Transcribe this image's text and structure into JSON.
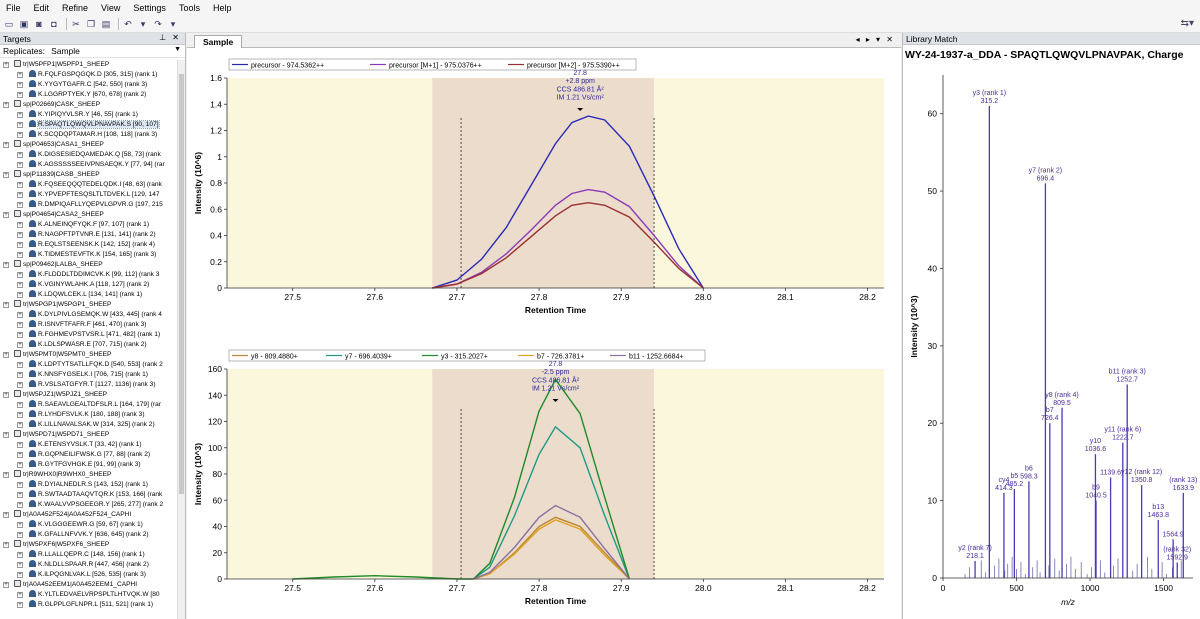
{
  "menu": [
    "File",
    "Edit",
    "Refine",
    "View",
    "Settings",
    "Tools",
    "Help"
  ],
  "targets": {
    "title": "Targets",
    "replicates_label": "Replicates:",
    "replicate_value": "Sample",
    "tree": [
      {
        "t": "prot",
        "label": "tr|W5PFP1|W5PFP1_SHEEP"
      },
      {
        "t": "pep",
        "label": "R.FQLFGSPQGQK.D [305, 315] (rank 1)"
      },
      {
        "t": "pep",
        "label": "K.YYGYTGAFR.C [542, 550] (rank 3)"
      },
      {
        "t": "pep",
        "label": "K.LGGRPTYEK.Y [670, 678] (rank 2)"
      },
      {
        "t": "prot",
        "label": "sp|P02669|CASK_SHEEP"
      },
      {
        "t": "pep",
        "label": "K.YIPIQYVLSR.Y [46, 55] (rank 1)"
      },
      {
        "t": "pep",
        "label": "R.SPAQTLQWQVLPNAVPAK.S [90, 107]",
        "sel": true
      },
      {
        "t": "pep",
        "label": "K.SCQDQPTAMAR.H [108, 118] (rank 3)"
      },
      {
        "t": "prot",
        "label": "sp|P04653|CASA1_SHEEP"
      },
      {
        "t": "pep",
        "label": "K.DIGSESIEDQAMEDAK.Q [58, 73] (rank"
      },
      {
        "t": "pep",
        "label": "K.AGSSSSSEEIVPNSAEQK.Y [77, 94] (rar"
      },
      {
        "t": "prot",
        "label": "sp|P11839|CASB_SHEEP"
      },
      {
        "t": "pep",
        "label": "K.FQSEEQQQTEDELQDK.I [48, 63] (rank"
      },
      {
        "t": "pep",
        "label": "K.YPVEPFTESQSLTLTDVEK.L [129, 147"
      },
      {
        "t": "pep",
        "label": "R.DMPIQAFLLYQEPVLGPVR.G [197, 215"
      },
      {
        "t": "prot",
        "label": "sp|P04654|CASA2_SHEEP"
      },
      {
        "t": "pep",
        "label": "K.ALNEINQFYQK.F [97, 107] (rank 1)"
      },
      {
        "t": "pep",
        "label": "R.NAGPFTPTVNR.E [131, 141] (rank 2)"
      },
      {
        "t": "pep",
        "label": "R.EQLSTSEENSK.K [142, 152] (rank 4)"
      },
      {
        "t": "pep",
        "label": "K.TIDMESTEVFTK.K [154, 165] (rank 3)"
      },
      {
        "t": "prot",
        "label": "sp|P09462|LALBA_SHEEP"
      },
      {
        "t": "pep",
        "label": "K.FLDDDLTDDIMCVK.K [99, 112] (rank 3"
      },
      {
        "t": "pep",
        "label": "K.VGINYWLAHK.A [118, 127] (rank 2)"
      },
      {
        "t": "pep",
        "label": "K.LDQWLCEK.L [134, 141] (rank 1)"
      },
      {
        "t": "prot",
        "label": "tr|W5PGP1|W5PGP1_SHEEP"
      },
      {
        "t": "pep",
        "label": "K.DYLPIVLGSEMQK.W [433, 445] (rank 4"
      },
      {
        "t": "pep",
        "label": "R.ISNVFTFAFR.F [461, 470] (rank 3)"
      },
      {
        "t": "pep",
        "label": "R.FGHMEVPSTVSR.L [471, 482] (rank 1)"
      },
      {
        "t": "pep",
        "label": "K.LDLSPWASR.E [707, 715] (rank 2)"
      },
      {
        "t": "prot",
        "label": "tr|W5PMT0|W5PMT0_SHEEP"
      },
      {
        "t": "pep",
        "label": "K.LDPTYTSATLLFQK.D [540, 553] (rank 2"
      },
      {
        "t": "pep",
        "label": "K.NNSFYGSELK.I [706, 715] (rank 1)"
      },
      {
        "t": "pep",
        "label": "R.VSLSATGFYR.T [1127, 1136] (rank 3)"
      },
      {
        "t": "prot",
        "label": "tr|W5PJZ1|W5PJZ1_SHEEP"
      },
      {
        "t": "pep",
        "label": "R.SAEAVLGEALTDFSLR.L [164, 179] (rar"
      },
      {
        "t": "pep",
        "label": "R.LYHDFSVLK.K [180, 188] (rank 3)"
      },
      {
        "t": "pep",
        "label": "K.LILLNAVALSAK.W [314, 325] (rank 2)"
      },
      {
        "t": "prot",
        "label": "tr|W5PD71|W5PD71_SHEEP"
      },
      {
        "t": "pep",
        "label": "K.ETENSYVSLK.T [33, 42] (rank 1)"
      },
      {
        "t": "pep",
        "label": "R.GQPNEILIFWSK.G [77, 88] (rank 2)"
      },
      {
        "t": "pep",
        "label": "R.GYTFGVHGK.E [91, 99] (rank 3)"
      },
      {
        "t": "prot",
        "label": "tr|R9WHX0|R9WHX0_SHEEP"
      },
      {
        "t": "pep",
        "label": "R.DYIALNEDLR.S [143, 152] (rank 1)"
      },
      {
        "t": "pep",
        "label": "R.SWTAADTAAQVTQR.K [153, 166] (rank"
      },
      {
        "t": "pep",
        "label": "K.WAALVVPSGEEGR.Y [265, 277] (rank 2"
      },
      {
        "t": "prot",
        "label": "tr|A0A452F524|A0A452F524_CAPHI"
      },
      {
        "t": "pep",
        "label": "K.VLGGGEEWR.G [59, 67] (rank 1)"
      },
      {
        "t": "pep",
        "label": "K.GFALLNFVVK.Y [636, 645] (rank 2)"
      },
      {
        "t": "prot",
        "label": "tr|W5PXF6|W5PXF6_SHEEP"
      },
      {
        "t": "pep",
        "label": "R.LLALLQEPR.C [148, 156] (rank 1)"
      },
      {
        "t": "pep",
        "label": "K.NLDLLSPAAR.R [447, 456] (rank 2)"
      },
      {
        "t": "pep",
        "label": "K.ILPQGNLVAK.L [526, 535] (rank 3)"
      },
      {
        "t": "prot",
        "label": "tr|A0A452EEM1|A0A452EEM1_CAPHI"
      },
      {
        "t": "pep",
        "label": "K.YLTLEDVAELVRPSPLTLHTVQK.W [80"
      },
      {
        "t": "pep",
        "label": "R.GLPPLGFLNPR.L [511, 521] (rank 1)"
      }
    ]
  },
  "sample_tab": {
    "label": "Sample"
  },
  "library": {
    "title": "Library Match"
  },
  "colors": {
    "precursor": "#2a2ab8",
    "m1": "#8a3ab8",
    "m2": "#9a3030",
    "y8": "#b8862e",
    "y7": "#1e9a86",
    "y3": "#1f8a2a",
    "b7": "#e0a020",
    "b11": "#8870a0",
    "band": "#ecdccc",
    "plotbg": "#fbf7dc",
    "spectrum": "#4a3ab8"
  },
  "chart_data": [
    {
      "type": "line",
      "title": "",
      "xlabel": "Retention Time",
      "ylabel": "Intensity (10^6)",
      "xlim": [
        27.42,
        28.22
      ],
      "ylim": [
        0,
        1.6
      ],
      "xticks": [
        27.5,
        27.6,
        27.7,
        27.8,
        27.9,
        28.0,
        28.1,
        28.2
      ],
      "yticks": [
        0,
        0.2,
        0.4,
        0.6,
        0.8,
        1.0,
        1.2,
        1.4,
        1.6
      ],
      "ytick_labels": [
        "0",
        "0.2",
        "0.4",
        "0.6",
        "0.8",
        "1",
        "1.2",
        "1.4",
        "1.6"
      ],
      "integration_range": [
        27.67,
        27.94
      ],
      "boundary_lines": [
        27.705,
        27.94
      ],
      "annotation": {
        "x": 27.85,
        "lines": [
          "27.8",
          "+2.8 ppm",
          "CCS 486.81 Å²",
          "IM 1.21 Vs/cm²"
        ]
      },
      "legend": "top-left",
      "series": [
        {
          "name": "precursor - 974.5362++",
          "color": "#2a2ab8",
          "x": [
            27.67,
            27.7,
            27.73,
            27.76,
            27.79,
            27.82,
            27.84,
            27.86,
            27.88,
            27.91,
            27.94,
            27.97,
            28.0
          ],
          "y": [
            0.0,
            0.06,
            0.22,
            0.46,
            0.78,
            1.1,
            1.26,
            1.31,
            1.28,
            1.08,
            0.7,
            0.3,
            0.0
          ]
        },
        {
          "name": "precursor [M+1] - 975.0376++",
          "color": "#8a3ab8",
          "x": [
            27.67,
            27.7,
            27.73,
            27.76,
            27.79,
            27.82,
            27.84,
            27.86,
            27.88,
            27.91,
            27.94,
            27.97,
            28.0
          ],
          "y": [
            0.0,
            0.03,
            0.12,
            0.26,
            0.44,
            0.63,
            0.72,
            0.75,
            0.73,
            0.62,
            0.4,
            0.17,
            0.0
          ]
        },
        {
          "name": "precursor [M+2] - 975.5390++",
          "color": "#9a3030",
          "x": [
            27.67,
            27.7,
            27.73,
            27.76,
            27.79,
            27.82,
            27.84,
            27.86,
            27.88,
            27.91,
            27.94,
            27.97,
            28.0
          ],
          "y": [
            0.0,
            0.03,
            0.11,
            0.23,
            0.39,
            0.55,
            0.63,
            0.65,
            0.63,
            0.54,
            0.35,
            0.15,
            0.0
          ]
        }
      ]
    },
    {
      "type": "line",
      "title": "",
      "xlabel": "Retention Time",
      "ylabel": "Intensity (10^3)",
      "xlim": [
        27.42,
        28.22
      ],
      "ylim": [
        0,
        160
      ],
      "xticks": [
        27.5,
        27.6,
        27.7,
        27.8,
        27.9,
        28.0,
        28.1,
        28.2
      ],
      "yticks": [
        0,
        20,
        40,
        60,
        80,
        100,
        120,
        140,
        160
      ],
      "ytick_labels": [
        "0",
        "20",
        "40",
        "60",
        "80",
        "100",
        "120",
        "140",
        "160"
      ],
      "integration_range": [
        27.67,
        27.94
      ],
      "boundary_lines": [
        27.705,
        27.94
      ],
      "annotation": {
        "x": 27.82,
        "lines": [
          "27.8",
          "-2.5 ppm",
          "CCS 486.81 Å²",
          "IM 1.21 Vs/cm²"
        ]
      },
      "legend": "top-left",
      "series": [
        {
          "name": "y8 - 809.4880+",
          "color": "#b8862e",
          "x": [
            27.72,
            27.74,
            27.77,
            27.8,
            27.82,
            27.85,
            27.88,
            27.91
          ],
          "y": [
            0,
            4,
            20,
            40,
            47,
            40,
            20,
            0
          ]
        },
        {
          "name": "y7 - 696.4039+",
          "color": "#1e9a86",
          "x": [
            27.72,
            27.74,
            27.77,
            27.8,
            27.82,
            27.85,
            27.88,
            27.91
          ],
          "y": [
            0,
            9,
            48,
            95,
            116,
            100,
            48,
            0
          ]
        },
        {
          "name": "y3 - 315.2027+",
          "color": "#1f8a2a",
          "x": [
            27.5,
            27.55,
            27.6,
            27.65,
            27.7,
            27.72,
            27.74,
            27.77,
            27.8,
            27.82,
            27.85,
            27.88,
            27.91
          ],
          "y": [
            0,
            1.5,
            2.5,
            1.5,
            0,
            0,
            12,
            62,
            128,
            152,
            126,
            62,
            0
          ]
        },
        {
          "name": "b7 - 726.3781+",
          "color": "#e0a020",
          "x": [
            27.72,
            27.74,
            27.77,
            27.8,
            27.82,
            27.85,
            27.88,
            27.91
          ],
          "y": [
            0,
            4,
            19,
            38,
            45,
            38,
            18,
            0
          ]
        },
        {
          "name": "b11 - 1252.6684+",
          "color": "#8870a0",
          "x": [
            27.72,
            27.74,
            27.77,
            27.8,
            27.82,
            27.85,
            27.88,
            27.91
          ],
          "y": [
            0,
            5,
            24,
            47,
            56,
            47,
            23,
            0
          ]
        }
      ]
    },
    {
      "type": "bar",
      "title": "WY-24-1937-a_DDA - SPAQTLQWQVLPNAVPAK, Charge",
      "xlabel": "m/z",
      "ylabel": "Intensity (10^3)",
      "xlim": [
        0,
        1700
      ],
      "ylim": [
        0,
        65
      ],
      "xticks": [
        0,
        500,
        1000,
        1500
      ],
      "yticks": [
        0,
        10,
        20,
        30,
        40,
        50,
        60
      ],
      "peaks": [
        {
          "mz": 218.1,
          "i": 2.2,
          "label": "y2 (rank 7)|218.1"
        },
        {
          "mz": 315.2,
          "i": 61,
          "label": "y3 (rank 1)|315.2"
        },
        {
          "mz": 414.3,
          "i": 11,
          "label": "cy4|414.3"
        },
        {
          "mz": 485.2,
          "i": 11.5,
          "label": "b5|485.2"
        },
        {
          "mz": 584.3,
          "i": 12.5,
          "label": "b6|598.3"
        },
        {
          "mz": 696.4,
          "i": 51,
          "label": "y7 (rank 2)|696.4"
        },
        {
          "mz": 726.4,
          "i": 20,
          "label": "b7|726.4"
        },
        {
          "mz": 809.5,
          "i": 22,
          "label": "y8 (rank 4)|809.5"
        },
        {
          "mz": 1036.6,
          "i": 16,
          "label": "y10|1036.6"
        },
        {
          "mz": 1040.5,
          "i": 10,
          "label": "b9|1040.5"
        },
        {
          "mz": 1139.6,
          "i": 13,
          "label": "1139.6"
        },
        {
          "mz": 1222.7,
          "i": 17.5,
          "label": "y11 (rank 6)|1222.7"
        },
        {
          "mz": 1252.7,
          "i": 25,
          "label": "b11 (rank 3)|1252.7"
        },
        {
          "mz": 1350.8,
          "i": 12,
          "label": "y12 (rank 12)|1350.8"
        },
        {
          "mz": 1463.8,
          "i": 7.5,
          "label": "b13|1463.8"
        },
        {
          "mz": 1564.9,
          "i": 5,
          "label": "1564.9"
        },
        {
          "mz": 1633.9,
          "i": 11,
          "label": "(rank 13)|1633.9"
        },
        {
          "mz": 1592.9,
          "i": 2,
          "label": "(rank 32)|1592.9"
        }
      ]
    }
  ]
}
